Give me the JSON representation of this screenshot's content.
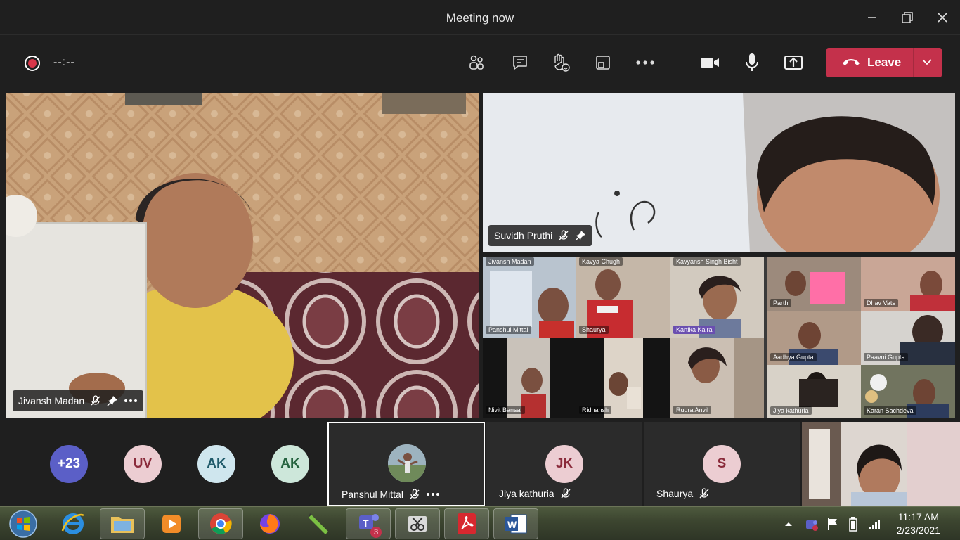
{
  "window": {
    "title": "Meeting now"
  },
  "toolbar": {
    "timer": "--:--",
    "leave_label": "Leave"
  },
  "tiles": {
    "main_left": {
      "name": "Jivansh Madan"
    },
    "main_right": {
      "name": "Suvidh Pruthi"
    }
  },
  "grid_names": [
    "Jivansh Madan",
    "Kavya Chugh",
    "Kavyansh Singh Bisht",
    "Parth",
    "Dhav Vats",
    "Panshul Mittal",
    "Shaurya",
    "Kartika Kalra",
    "Aadhya Gupta",
    "Paavni Gupta",
    "Nivit Bansal",
    "Ridhansh",
    "Rudra Anvil",
    "Jiya kathuria",
    "Karan Sachdeva"
  ],
  "participants": [
    {
      "initials": "+23",
      "color": "#5b5fc7",
      "text_color": "#ffffff"
    },
    {
      "initials": "UV",
      "color": "#eccdd2",
      "text_color": "#8a2b3b"
    },
    {
      "initials": "AK",
      "color": "#cfe6ee",
      "text_color": "#1f5a6a"
    },
    {
      "initials": "AK",
      "color": "#cde7da",
      "text_color": "#25633f"
    }
  ],
  "strip_tiles": [
    {
      "name": "Panshul Mittal"
    },
    {
      "name": "Jiya kathuria",
      "initials": "JK",
      "color": "#eccdd2",
      "text_color": "#8a2b3b"
    },
    {
      "name": "Shaurya",
      "initials": "S",
      "color": "#eccdd2",
      "text_color": "#8a2b3b"
    }
  ],
  "taskbar": {
    "teams_badge": "3",
    "time": "11:17 AM",
    "date": "2/23/2021"
  }
}
